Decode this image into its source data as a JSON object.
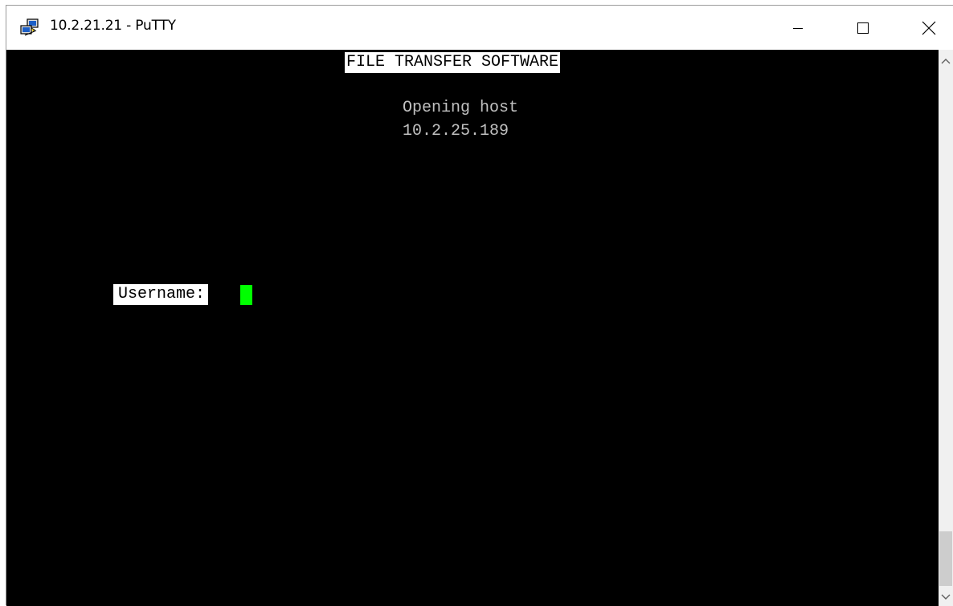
{
  "window": {
    "title": "10.2.21.21 - PuTTY",
    "icon": "putty-icon",
    "controls": {
      "minimize": "minimize-icon",
      "maximize": "maximize-icon",
      "close": "close-icon"
    }
  },
  "terminal": {
    "banner": "FILE TRANSFER SOFTWARE",
    "status_line": "Opening host",
    "host_address": "10.2.25.189",
    "prompt_label": "Username:",
    "input_value": "",
    "colors": {
      "background": "#000000",
      "foreground": "#c0c0c0",
      "highlight_bg": "#ffffff",
      "cursor": "#00ff00"
    }
  },
  "scrollbar": {
    "up_icon": "chevron-up-icon",
    "down_icon": "chevron-down-icon"
  }
}
